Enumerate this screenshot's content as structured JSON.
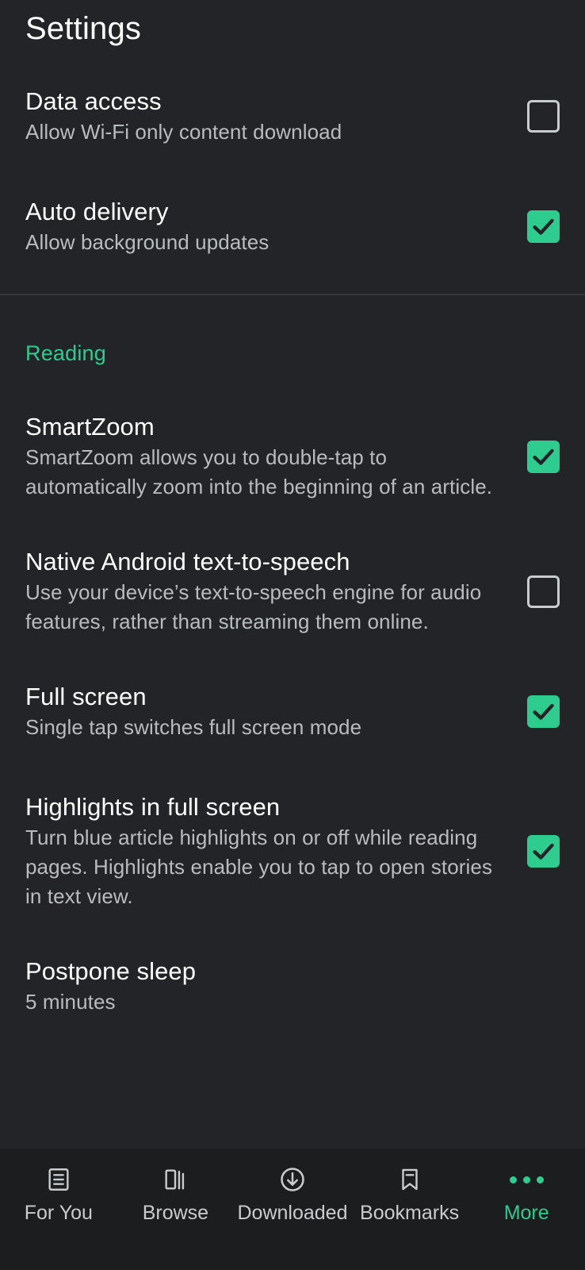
{
  "header": {
    "title": "Settings"
  },
  "settings": {
    "top_items": [
      {
        "title": "Data access",
        "desc": "Allow Wi-Fi only content download",
        "checked": false,
        "name": "data-access"
      },
      {
        "title": "Auto delivery",
        "desc": "Allow background updates",
        "checked": true,
        "name": "auto-delivery"
      }
    ],
    "reading_section": {
      "label": "Reading",
      "items": [
        {
          "title": "SmartZoom",
          "desc": "SmartZoom allows you to double-tap to automatically zoom into the beginning of an article.",
          "checked": true,
          "name": "smartzoom"
        },
        {
          "title": "Native Android text-to-speech",
          "desc": "Use your device’s text-to-speech engine for audio features, rather than streaming them online.",
          "checked": false,
          "name": "native-tts"
        },
        {
          "title": "Full screen",
          "desc": "Single tap switches full screen mode",
          "checked": true,
          "name": "full-screen"
        },
        {
          "title": "Highlights in full screen",
          "desc": "Turn blue article highlights on or off while reading pages. Highlights enable you to tap to open stories in text view.",
          "checked": true,
          "name": "highlights-full-screen"
        },
        {
          "title": "Postpone sleep",
          "desc": "5 minutes",
          "checked": null,
          "name": "postpone-sleep"
        }
      ]
    }
  },
  "bottom_nav": {
    "items": [
      {
        "label": "For You",
        "icon": "article-list-icon",
        "active": false
      },
      {
        "label": "Browse",
        "icon": "books-icon",
        "active": false
      },
      {
        "label": "Downloaded",
        "icon": "download-circle-icon",
        "active": false
      },
      {
        "label": "Bookmarks",
        "icon": "bookmark-icon",
        "active": false
      },
      {
        "label": "More",
        "icon": "more-dots-icon",
        "active": true
      }
    ]
  },
  "colors": {
    "accent": "#2ecc8f",
    "background": "#222427",
    "navbar_background": "#1b1d1f",
    "primary_text": "#ffffff",
    "secondary_text": "#b9bcbf",
    "divider": "#34383b"
  }
}
